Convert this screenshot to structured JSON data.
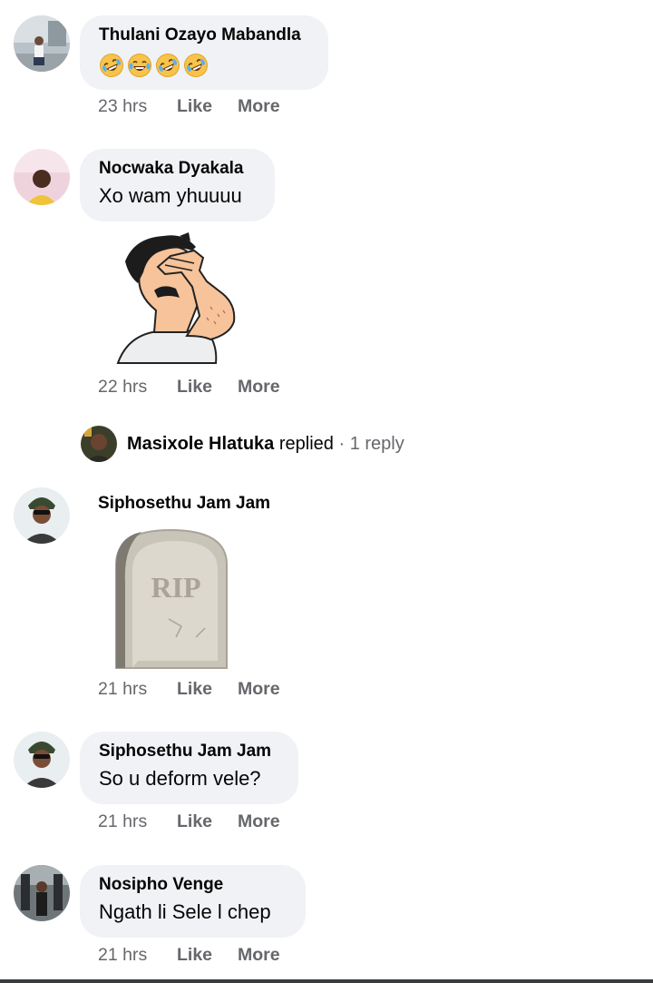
{
  "comments": [
    {
      "name": "Thulani Ozayo Mabandla",
      "emoji": [
        "rofl-icon",
        "laughing-icon",
        "rofl-icon",
        "rofl-icon"
      ],
      "time": "23 hrs",
      "like": "Like",
      "more": "More"
    },
    {
      "name": "Nocwaka Dyakala",
      "text": "Xo wam yhuuuu",
      "sticker": "facepalm-sticker",
      "time": "22 hrs",
      "like": "Like",
      "more": "More"
    },
    {
      "name": "Siphosethu Jam Jam",
      "sticker": "rip-tombstone-sticker",
      "sticker_text": "RIP",
      "time": "21 hrs",
      "like": "Like",
      "more": "More"
    },
    {
      "name": "Siphosethu Jam Jam",
      "text": "So u deform vele?",
      "time": "21 hrs",
      "like": "Like",
      "more": "More"
    },
    {
      "name": "Nosipho Venge",
      "text": "Ngath li Sele l chep",
      "time": "21 hrs",
      "like": "Like",
      "more": "More"
    }
  ],
  "reply_summary": {
    "name": "Masixole Hlatuka",
    "action": "replied",
    "separator": "·",
    "count": "1 reply"
  },
  "colors": {
    "bubble": "#f0f2f5",
    "meta_text": "#65676b",
    "primary_text": "#050505"
  }
}
